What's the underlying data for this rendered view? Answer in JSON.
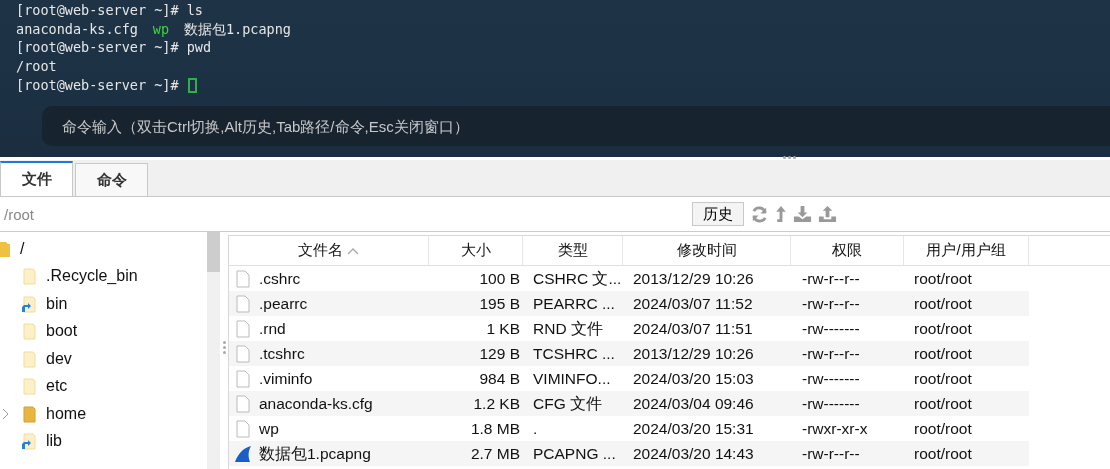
{
  "terminal": {
    "lines": [
      {
        "segments": [
          {
            "text": "[root@web-server ~]# ls",
            "kind": "plain"
          }
        ],
        "cursor": false
      },
      {
        "segments": [
          {
            "text": "anaconda-ks.cfg",
            "kind": "plain"
          },
          {
            "text": "wp",
            "kind": "executable"
          },
          {
            "text": "数据包1.pcapng",
            "kind": "plain"
          }
        ],
        "cursor": false
      },
      {
        "segments": [
          {
            "text": "[root@web-server ~]# pwd",
            "kind": "plain"
          }
        ],
        "cursor": false
      },
      {
        "segments": [
          {
            "text": "/root",
            "kind": "plain"
          }
        ],
        "cursor": false
      },
      {
        "segments": [
          {
            "text": "[root@web-server ~]#",
            "kind": "plain"
          }
        ],
        "cursor": true
      }
    ],
    "command_bar": {
      "placeholder": "命令输入（双击Ctrl切换,Alt历史,Tab路径/命令,Esc关闭窗口）"
    }
  },
  "tabs": [
    {
      "label": "文件",
      "selected": true
    },
    {
      "label": "命令",
      "selected": false
    }
  ],
  "path_bar": {
    "value": "/root",
    "history_button": "历史"
  },
  "tree": {
    "name": "/",
    "children": [
      {
        "name": ".Recycle_bin",
        "kind": "folder",
        "has_children": false
      },
      {
        "name": "bin",
        "kind": "link",
        "has_children": false
      },
      {
        "name": "boot",
        "kind": "folder",
        "has_children": false
      },
      {
        "name": "dev",
        "kind": "folder",
        "has_children": false
      },
      {
        "name": "etc",
        "kind": "folder",
        "has_children": false
      },
      {
        "name": "home",
        "kind": "folder",
        "has_children": true
      },
      {
        "name": "lib",
        "kind": "link",
        "has_children": false
      }
    ]
  },
  "table": {
    "columns": [
      {
        "label": "文件名",
        "sorted": true
      },
      {
        "label": "大小",
        "sorted": false
      },
      {
        "label": "类型",
        "sorted": false
      },
      {
        "label": "修改时间",
        "sorted": false
      },
      {
        "label": "权限",
        "sorted": false
      },
      {
        "label": "用户/用户组",
        "sorted": false
      }
    ],
    "rows": [
      {
        "kind": "file",
        "name": ".cshrc",
        "size": "100 B",
        "type": "CSHRC 文...",
        "modified": "2013/12/29 10:26",
        "permissions": "-rw-r--r--",
        "owner": "root/root"
      },
      {
        "kind": "file",
        "name": ".pearrc",
        "size": "195 B",
        "type": "PEARRC ...",
        "modified": "2024/03/07 11:52",
        "permissions": "-rw-r--r--",
        "owner": "root/root"
      },
      {
        "kind": "file",
        "name": ".rnd",
        "size": "1 KB",
        "type": "RND 文件",
        "modified": "2024/03/07 11:51",
        "permissions": "-rw-------",
        "owner": "root/root"
      },
      {
        "kind": "file",
        "name": ".tcshrc",
        "size": "129 B",
        "type": "TCSHRC ...",
        "modified": "2013/12/29 10:26",
        "permissions": "-rw-r--r--",
        "owner": "root/root"
      },
      {
        "kind": "file",
        "name": ".viminfo",
        "size": "984 B",
        "type": "VIMINFO...",
        "modified": "2024/03/20 15:03",
        "permissions": "-rw-------",
        "owner": "root/root"
      },
      {
        "kind": "file",
        "name": "anaconda-ks.cfg",
        "size": "1.2 KB",
        "type": "CFG 文件",
        "modified": "2024/03/04 09:46",
        "permissions": "-rw-------",
        "owner": "root/root"
      },
      {
        "kind": "file",
        "name": "wp",
        "size": "1.8 MB",
        "type": ".",
        "modified": "2024/03/20 15:31",
        "permissions": "-rwxr-xr-x",
        "owner": "root/root"
      },
      {
        "kind": "capture",
        "name": "数据包1.pcapng",
        "size": "2.7 MB",
        "type": "PCAPNG ...",
        "modified": "2024/03/20 14:43",
        "permissions": "-rw-r--r--",
        "owner": "root/root"
      }
    ]
  }
}
